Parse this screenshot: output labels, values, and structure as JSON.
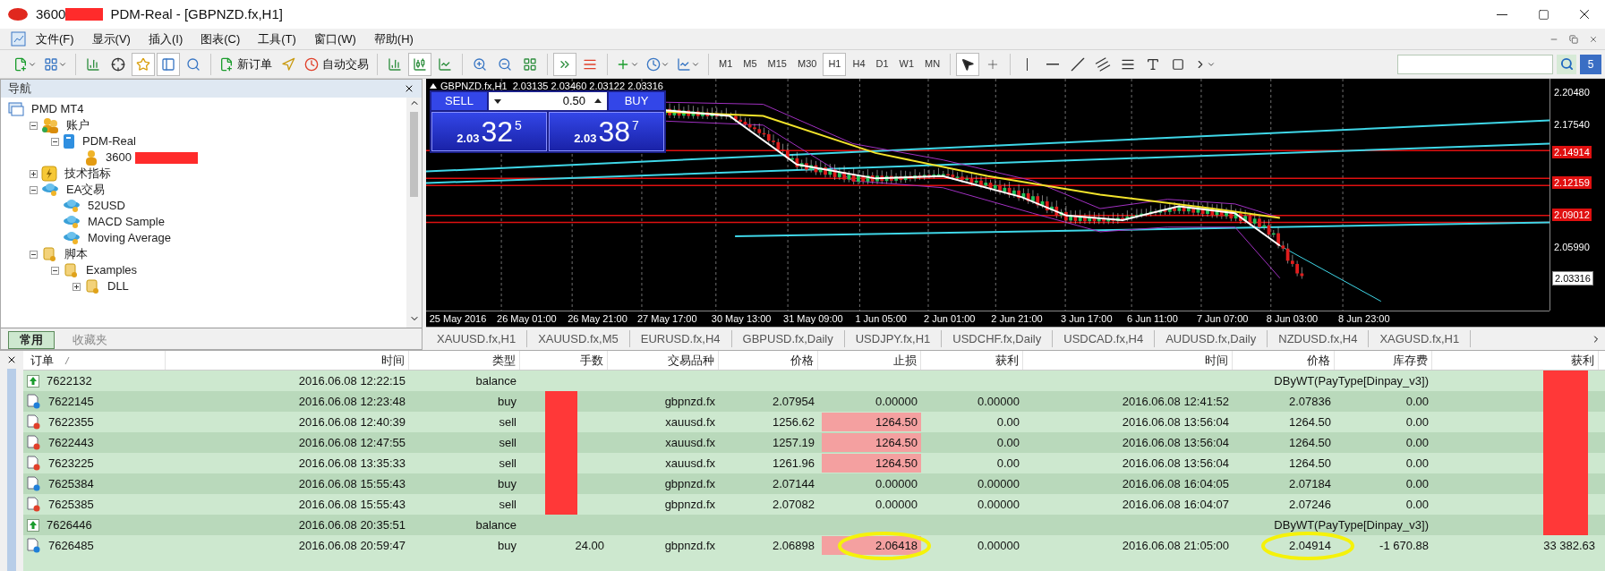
{
  "window": {
    "title_prefix": "3600",
    "title": "PDM-Real - [GBPNZD.fx,H1]",
    "title_redacted": true
  },
  "menu": [
    "文件(F)",
    "显示(V)",
    "插入(I)",
    "图表(C)",
    "工具(T)",
    "窗口(W)",
    "帮助(H)"
  ],
  "toolbar": {
    "new_order": "新订单",
    "auto_trading": "自动交易",
    "notifications": "5",
    "timeframes": [
      {
        "label": "M1",
        "selected": false
      },
      {
        "label": "M5",
        "selected": false
      },
      {
        "label": "M15",
        "selected": false
      },
      {
        "label": "M30",
        "selected": false
      },
      {
        "label": "H1",
        "selected": true
      },
      {
        "label": "H4",
        "selected": false
      },
      {
        "label": "D1",
        "selected": false
      },
      {
        "label": "W1",
        "selected": false
      },
      {
        "label": "MN",
        "selected": false
      }
    ]
  },
  "navigator": {
    "title": "导航",
    "tree": [
      {
        "label": "PMD MT4",
        "kind": "terminal",
        "children": [
          {
            "label": "账户",
            "kind": "accounts",
            "expanded": true,
            "children": [
              {
                "label": "PDM-Real",
                "kind": "server",
                "expanded": true,
                "children": [
                  {
                    "label": "3600",
                    "kind": "account",
                    "redacted": true
                  }
                ]
              }
            ]
          },
          {
            "label": "技术指标",
            "kind": "indicators",
            "expanded": false
          },
          {
            "label": "EA交易",
            "kind": "experts",
            "expanded": true,
            "children": [
              {
                "label": "52USD",
                "kind": "expert"
              },
              {
                "label": "MACD Sample",
                "kind": "expert"
              },
              {
                "label": "Moving Average",
                "kind": "expert"
              }
            ]
          },
          {
            "label": "脚本",
            "kind": "scripts",
            "expanded": true,
            "children": [
              {
                "label": "Examples",
                "kind": "scripts",
                "expanded": true,
                "children": [
                  {
                    "label": "DLL",
                    "kind": "scripts",
                    "expanded": false
                  }
                ]
              }
            ]
          }
        ]
      }
    ],
    "tabs": [
      {
        "label": "常用",
        "selected": true
      },
      {
        "label": "收藏夹",
        "selected": false
      }
    ]
  },
  "chart": {
    "header": "GBPNZD.fx,H1  2.03135 2.03460 2.03122 2.03316",
    "trade_panel": {
      "sell": "SELL",
      "buy": "BUY",
      "lots": "0.50",
      "sell_price": {
        "prefix": "2.03",
        "main": "32",
        "sup": "5"
      },
      "buy_price": {
        "prefix": "2.03",
        "main": "38",
        "sup": "7"
      }
    },
    "price_labels": [
      {
        "text": "2.20480",
        "kind": "plain"
      },
      {
        "text": "2.17540",
        "kind": "plain"
      },
      {
        "text": "2.14914",
        "kind": "level"
      },
      {
        "text": "2.12159",
        "kind": "level"
      },
      {
        "text": "2.09012",
        "kind": "level"
      },
      {
        "text": "2.05990",
        "kind": "plain"
      },
      {
        "text": "2.03316",
        "kind": "current"
      }
    ],
    "time_labels": [
      "25 May 2016",
      "26 May 01:00",
      "26 May 21:00",
      "27 May 17:00",
      "30 May 13:00",
      "31 May 09:00",
      "1 Jun 05:00",
      "2 Jun 01:00",
      "2 Jun 21:00",
      "3 Jun 17:00",
      "6 Jun 11:00",
      "7 Jun 07:00",
      "8 Jun 03:00",
      "8 Jun 23:00"
    ]
  },
  "chart_tabs": [
    "XAUUSD.fx,H1",
    "XAUUSD.fx,M5",
    "EURUSD.fx,H4",
    "GBPUSD.fx,Daily",
    "USDJPY.fx,H1",
    "USDCHF.fx,Daily",
    "USDCAD.fx,H4",
    "AUDUSD.fx,Daily",
    "NZDUSD.fx,H4",
    "XAGUSD.fx,H1"
  ],
  "terminal": {
    "columns": [
      "订单",
      "时间",
      "类型",
      "手数",
      "交易品种",
      "价格",
      "止损",
      "获利",
      "时间",
      "价格",
      "库存费",
      "获利"
    ],
    "rows": [
      {
        "kind": "balance",
        "order": "7622132",
        "time": "2016.06.08 12:22:15",
        "type": "balance",
        "comment": "DByWT(PayType[Dinpay_v3])",
        "profit_redacted": true
      },
      {
        "kind": "buy",
        "order": "7622145",
        "time": "2016.06.08 12:23:48",
        "type": "buy",
        "lots_redacted": true,
        "symbol": "gbpnzd.fx",
        "price": "2.07954",
        "sl": "0.00000",
        "sl_hit": false,
        "tp": "0.00000",
        "close_time": "2016.06.08 12:41:52",
        "close_price": "2.07836",
        "swap": "0.00",
        "profit_redacted": true
      },
      {
        "kind": "sell",
        "order": "7622355",
        "time": "2016.06.08 12:40:39",
        "type": "sell",
        "lots_redacted": true,
        "symbol": "xauusd.fx",
        "price": "1256.62",
        "sl": "1264.50",
        "sl_hit": true,
        "tp": "0.00",
        "close_time": "2016.06.08 13:56:04",
        "close_price": "1264.50",
        "swap": "0.00",
        "profit_redacted": true
      },
      {
        "kind": "sell",
        "order": "7622443",
        "time": "2016.06.08 12:47:55",
        "type": "sell",
        "lots_redacted": true,
        "symbol": "xauusd.fx",
        "price": "1257.19",
        "sl": "1264.50",
        "sl_hit": true,
        "tp": "0.00",
        "close_time": "2016.06.08 13:56:04",
        "close_price": "1264.50",
        "swap": "0.00",
        "profit_redacted": true
      },
      {
        "kind": "sell",
        "order": "7623225",
        "time": "2016.06.08 13:35:33",
        "type": "sell",
        "lots_redacted": true,
        "symbol": "xauusd.fx",
        "price": "1261.96",
        "sl": "1264.50",
        "sl_hit": true,
        "tp": "0.00",
        "close_time": "2016.06.08 13:56:04",
        "close_price": "1264.50",
        "swap": "0.00",
        "profit_redacted": true
      },
      {
        "kind": "buy",
        "order": "7625384",
        "time": "2016.06.08 15:55:43",
        "type": "buy",
        "lots_redacted": true,
        "symbol": "gbpnzd.fx",
        "price": "2.07144",
        "sl": "0.00000",
        "sl_hit": false,
        "tp": "0.00000",
        "close_time": "2016.06.08 16:04:05",
        "close_price": "2.07184",
        "swap": "0.00",
        "profit_redacted": true
      },
      {
        "kind": "sell",
        "order": "7625385",
        "time": "2016.06.08 15:55:43",
        "type": "sell",
        "lots_redacted": true,
        "symbol": "gbpnzd.fx",
        "price": "2.07082",
        "sl": "0.00000",
        "sl_hit": false,
        "tp": "0.00000",
        "close_time": "2016.06.08 16:04:07",
        "close_price": "2.07246",
        "swap": "0.00",
        "profit_redacted": true
      },
      {
        "kind": "balance",
        "order": "7626446",
        "time": "2016.06.08 20:35:51",
        "type": "balance",
        "comment": "DByWT(PayType[Dinpay_v3])",
        "profit_redacted": true
      },
      {
        "kind": "buy",
        "order": "7626485",
        "time": "2016.06.08 20:59:47",
        "type": "buy",
        "lots": "24.00",
        "lots_redacted": false,
        "symbol": "gbpnzd.fx",
        "price": "2.06898",
        "sl": "2.06418",
        "sl_hit": true,
        "sl_circled": true,
        "tp": "0.00000",
        "close_time": "2016.06.08 21:05:00",
        "close_price": "2.04914",
        "close_price_circled": true,
        "swap": "-1 670.88",
        "profit": "33 382.63",
        "profit_redacted": false
      }
    ]
  }
}
